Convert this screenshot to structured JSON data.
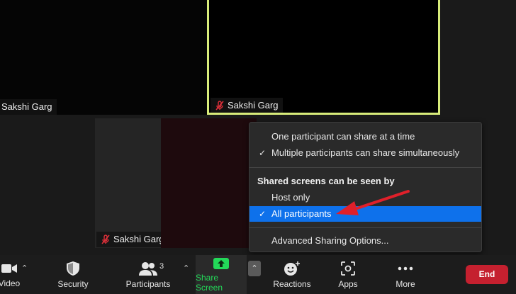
{
  "participants": [
    {
      "name": "Sakshi Garg"
    },
    {
      "name": "Sakshi Garg"
    },
    {
      "name": "Sakshi Garg"
    }
  ],
  "menu": {
    "items_top": [
      {
        "label": "One participant can share at a time",
        "checked": false
      },
      {
        "label": "Multiple participants can share simultaneously",
        "checked": true
      }
    ],
    "section_title": "Shared screens can be seen by",
    "items_viewers": [
      {
        "label": "Host only",
        "checked": false
      },
      {
        "label": "All participants",
        "checked": true,
        "highlighted": true
      }
    ],
    "advanced_label": "Advanced Sharing Options...",
    "check_glyph": "✓"
  },
  "toolbar": {
    "video_label": "Video",
    "security_label": "Security",
    "participants_label": "Participants",
    "participants_count": "3",
    "share_label": "Share Screen",
    "reactions_label": "Reactions",
    "apps_label": "Apps",
    "more_label": "More",
    "end_label": "End"
  },
  "colors": {
    "active_speaker_border": "#d8ec7a",
    "highlight": "#0e71eb",
    "end_button": "#c5202f",
    "share_icon_bg": "#23d959",
    "arrow": "#e0202a"
  },
  "icons": [
    "video-icon",
    "shield-icon",
    "participants-icon",
    "share-screen-icon",
    "reactions-icon",
    "apps-icon",
    "more-icon",
    "mute-icon",
    "caret-up-icon",
    "check-icon",
    "arrow-annotation"
  ]
}
